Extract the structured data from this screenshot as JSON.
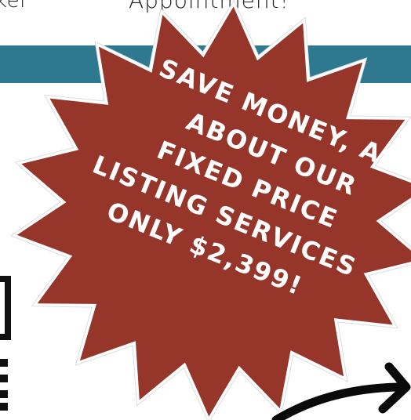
{
  "header": {
    "left_text": "ker",
    "center_text": "Appointment!"
  },
  "promo": {
    "lines": [
      "SAVE MONEY, ASK",
      "ABOUT OUR",
      "FIXED PRICE",
      "LISTING SERVICES",
      "ONLY $2,399!"
    ]
  },
  "colors": {
    "band": "#2e7890",
    "burst": "#96352a",
    "burst_text": "#ffffff"
  }
}
